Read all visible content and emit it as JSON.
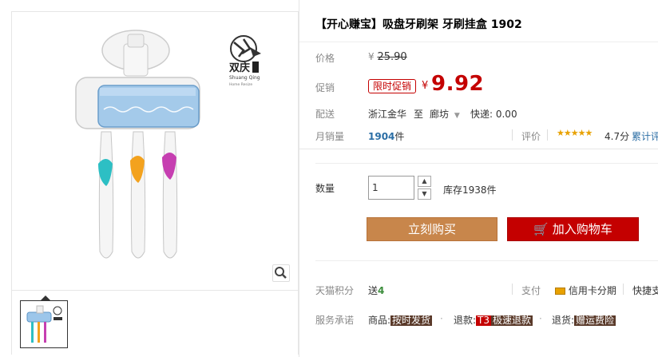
{
  "gallery": {
    "brand_cn": "双庆",
    "brand_en": "Shuang Qing",
    "brand_sub": "Home Resize"
  },
  "product": {
    "title": "【开心赚宝】吸盘牙刷架 牙刷挂盒 1902"
  },
  "price": {
    "label": "价格",
    "currency": "¥",
    "original": "25.90"
  },
  "promo": {
    "label": "促销",
    "tag": "限时促销",
    "currency": "¥",
    "price": "9.92"
  },
  "delivery": {
    "label": "配送",
    "from": "浙江金华",
    "to_word": "至",
    "destination": "廊坊",
    "shipping": "快递: 0.00"
  },
  "sales": {
    "label": "月销量",
    "count": "1904",
    "unit": "件",
    "rating_label": "评价",
    "rating": "4.7分",
    "reviews_label": "累计评"
  },
  "quantity": {
    "label": "数量",
    "value": "1",
    "stock": "库存1938件"
  },
  "buttons": {
    "buy_now": "立刻购买",
    "add_to_cart": "加入购物车"
  },
  "points": {
    "label": "天猫积分",
    "send": "送",
    "value": "4",
    "pay_label": "支付",
    "credit_card": "信用卡分期",
    "fast_pay": "快捷支"
  },
  "service": {
    "label": "服务承诺",
    "goods_label": "商品:",
    "goods_badge": "按时发货",
    "refund_label": "退款:",
    "refund_badge_prefix": "T3",
    "refund_badge": "极速退款",
    "return_label": "退货:",
    "return_badge": "赠运费险"
  },
  "colors": {
    "accent_red": "#c40000",
    "buy_orange": "#c8864b",
    "sales_blue": "#2b6ea5",
    "star_gold": "#e8a100"
  }
}
